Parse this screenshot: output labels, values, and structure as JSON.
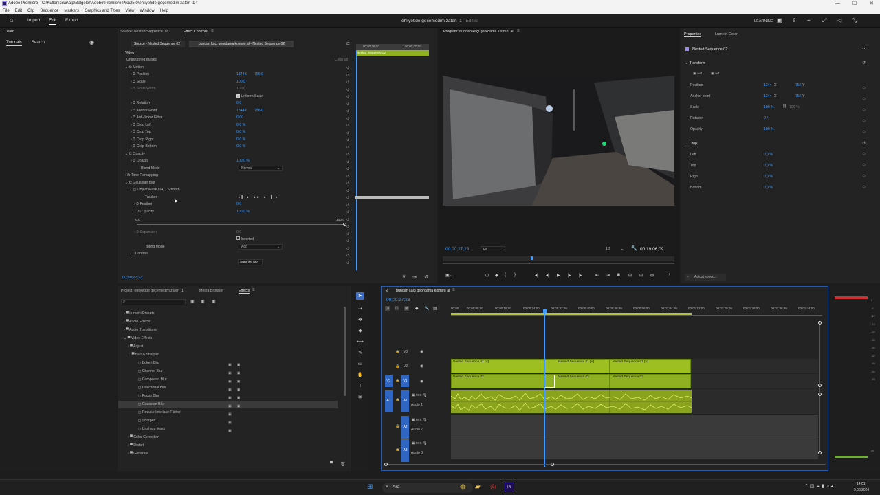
{
  "window": {
    "title": "Adobe Premiere - C:\\Kullanıcılar\\alp\\Belgeler\\Adobe\\Premiere Pro\\25.0\\ehliyetide geçemedim zaten_1 *"
  },
  "menu": [
    "File",
    "Edit",
    "Clip",
    "Sequence",
    "Markers",
    "Graphics and Titles",
    "View",
    "Window",
    "Help"
  ],
  "header": {
    "tabs": [
      "Import",
      "Edit",
      "Export"
    ],
    "document": "ehliyetide geçemedim zaten_1",
    "status": "- Edited",
    "workspace": "LEARNING"
  },
  "learn": {
    "title": "Learn",
    "tabs": [
      "Tutorials",
      "Search"
    ]
  },
  "effect_controls": {
    "tab_source": "Source: Nested Sequence 02",
    "tab_effects": "Effect Controls",
    "source_label": "Source - Nested Sequence 02",
    "clip_label": "bundan kaçı geordama kısmını al - Nested Sequence 02",
    "mini_tc_left": "00;00;28;00",
    "mini_tc_right": "00;00;30;00",
    "mini_clip": "Nested Sequence 02",
    "video_label": "Video",
    "unassigned_masks": "Unassigned Masks",
    "clear_all": "Clear all",
    "motion": "Motion",
    "position": "Position",
    "position_x": "1344,0",
    "position_y": "756,0",
    "scale": "Scale",
    "scale_val": "100,0",
    "scale_width": "Scale Width",
    "scale_width_val": "100,0",
    "uniform_scale": "Uniform Scale",
    "rotation": "Rotation",
    "rotation_val": "0,0",
    "anchor_point": "Anchor Point",
    "anchor_x": "1344,0",
    "anchor_y": "756,0",
    "anti_flicker": "Anti-flicker Filter",
    "anti_flicker_val": "0,00",
    "crop_left": "Crop Left",
    "crop_left_val": "0,0 %",
    "crop_top": "Crop Top",
    "crop_top_val": "0,0 %",
    "crop_right": "Crop Right",
    "crop_right_val": "0,0 %",
    "crop_bottom": "Crop Bottom",
    "crop_bottom_val": "0,0 %",
    "opacity_group": "Opacity",
    "opacity": "Opacity",
    "opacity_val": "100,0 %",
    "blend_mode": "Blend Mode",
    "blend_mode_val": "Normal",
    "time_remapping": "Time Remapping",
    "gaussian_blur": "Gaussian Blur",
    "object_mask": "Object Mask (04) - Smooth",
    "tracker": "Tracker",
    "feather": "Feather",
    "feather_val": "0,0",
    "mask_opacity": "Opacity",
    "mask_opacity_val": "100,0 %",
    "slider_min": "0,0",
    "slider_max": "100,0",
    "expansion": "Expansion",
    "expansion_val": "0,0",
    "inverted": "Inverted",
    "blend_mode2": "Blend Mode",
    "blend_mode2_val": "Add",
    "controls": "Controls",
    "surprise": "Surprise Me!",
    "timecode": "00;00;27;23"
  },
  "program": {
    "title": "Program: bundan kaçı geordama kısmını al",
    "timecode": "00;00;27;23",
    "fit": "Fit",
    "resolution": "1/2",
    "duration": "00;19;06;09"
  },
  "properties": {
    "tab1": "Properties",
    "tab2": "Lumetri Color",
    "clip": "Nested Sequence 02",
    "transform": "Transform",
    "fill": "Fill",
    "fit": "Fit",
    "position": "Position",
    "position_x": "1344",
    "x_label": "X",
    "position_y": "756",
    "y_label": "Y",
    "anchor": "Anchor point",
    "anchor_x": "1344",
    "anchor_y": "756",
    "scale": "Scale",
    "scale_val": "100 %",
    "scale_val2": "100 %",
    "rotation": "Rotation",
    "rotation_val": "0 °",
    "opacity": "Opacity",
    "opacity_val": "100 %",
    "crop": "Crop",
    "left": "Left",
    "left_val": "0,0 %",
    "top": "Top",
    "top_val": "0,0 %",
    "right": "Right",
    "right_val": "0,0 %",
    "bottom": "Bottom",
    "bottom_val": "0,0 %",
    "adjust_speed": "Adjust speed..."
  },
  "project": {
    "tab_project": "Project: ehliyetide geçemedim zaten_1",
    "tab_media": "Media Browser",
    "tab_effects": "Effects",
    "tree": [
      "Lumetri Presets",
      "Audio Effects",
      "Audio Transitions",
      "Video Effects",
      "Adjust",
      "Blur & Sharpen",
      "Bokeh Blur",
      "Channel Blur",
      "Compound Blur",
      "Directional Blur",
      "Focus Blur",
      "Gaussian Blur",
      "Reduce Interlace Flicker",
      "Sharpen",
      "Unsharp Mask",
      "Color Correction",
      "Distort",
      "Generate"
    ]
  },
  "timeline": {
    "sequence": "bundan kaçı geordama kısmını al",
    "timecode": "00;00;27;23",
    "ruler": [
      "00;00",
      "00;00;08;00",
      "00;00;16;00",
      "00;00;24;00",
      "00;00;32;00",
      "00;00;40;00",
      "00;00;48;00",
      "00;00;56;00",
      "00;01;04;00",
      "00;01;12;00",
      "00;01;20;00",
      "00;01;28;00",
      "00;01;36;00",
      "00;01;44;00"
    ],
    "tracks": {
      "v3": "V3",
      "v2": "V2",
      "v1": "V1",
      "a1": "A1",
      "a2": "A2",
      "a3": "A3",
      "audio1": "Audio 1",
      "audio2": "Audio 2",
      "audio3": "Audio 3"
    },
    "clip_v2_1": "Nested Sequence 01 [V]",
    "clip_v2_2": "Nested Sequence 01 [V]",
    "clip_v2_3": "Nested Sequence 01 [V]",
    "clip_v1_1": "Nested Sequence 02",
    "clip_v1_2": "Nested Sequence 02",
    "clip_v1_3": "Nested Sequence 02"
  },
  "taskbar": {
    "search": "Ara",
    "time": "14:01",
    "date": "9.08.2026"
  }
}
